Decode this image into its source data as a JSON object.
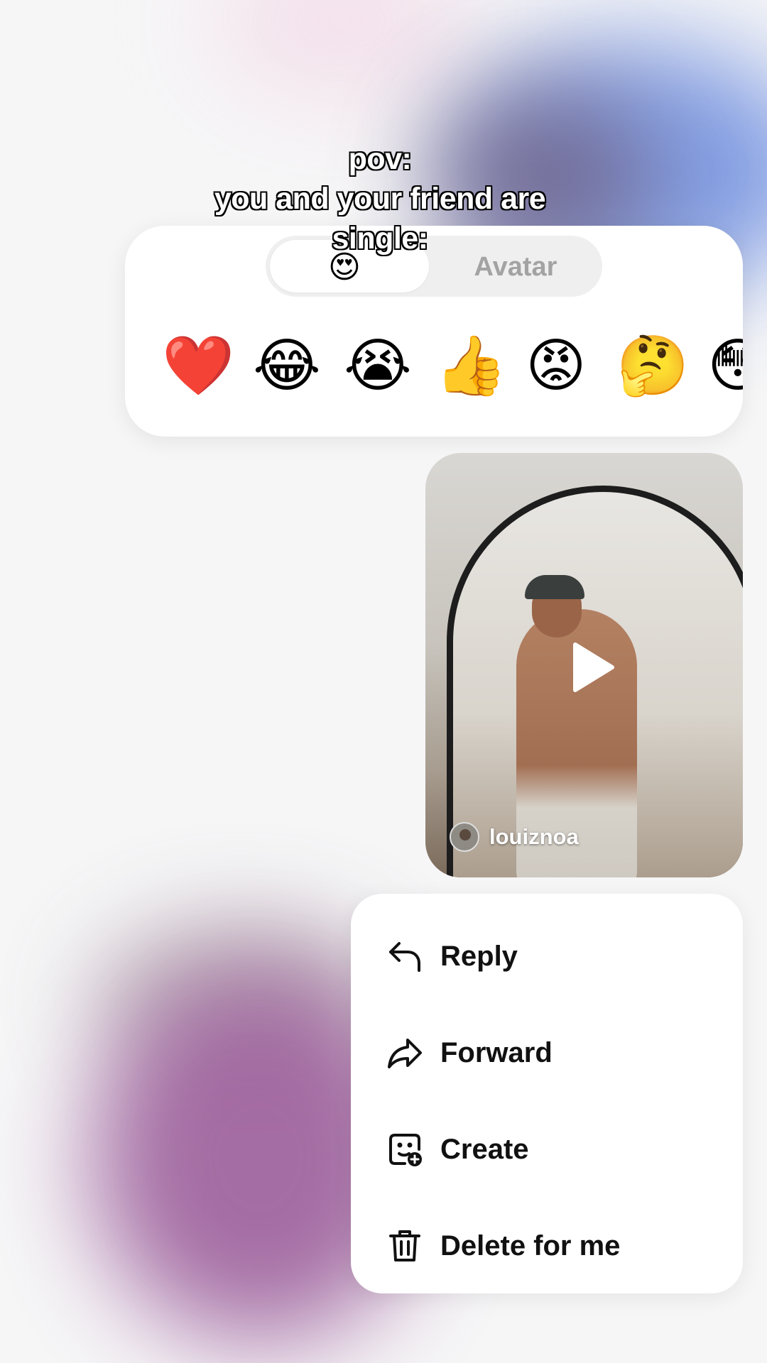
{
  "caption": {
    "line1": "pov:",
    "line2": "you and your friend are",
    "line3": "single:"
  },
  "reactions": {
    "tab_emoji": "😍",
    "tab_avatar_label": "Avatar",
    "emojis": [
      "❤️",
      "😂",
      "😭",
      "👍",
      "😡",
      "🤔",
      "😳"
    ]
  },
  "video": {
    "author": "louiznoa",
    "icons": {
      "play": "play-icon",
      "avatar": "author-avatar"
    }
  },
  "menu": {
    "reply_label": "Reply",
    "forward_label": "Forward",
    "create_label": "Create",
    "delete_label": "Delete for me",
    "icons": [
      "reply-arrow-icon",
      "forward-arrow-icon",
      "create-sticker-icon",
      "trash-icon"
    ]
  }
}
